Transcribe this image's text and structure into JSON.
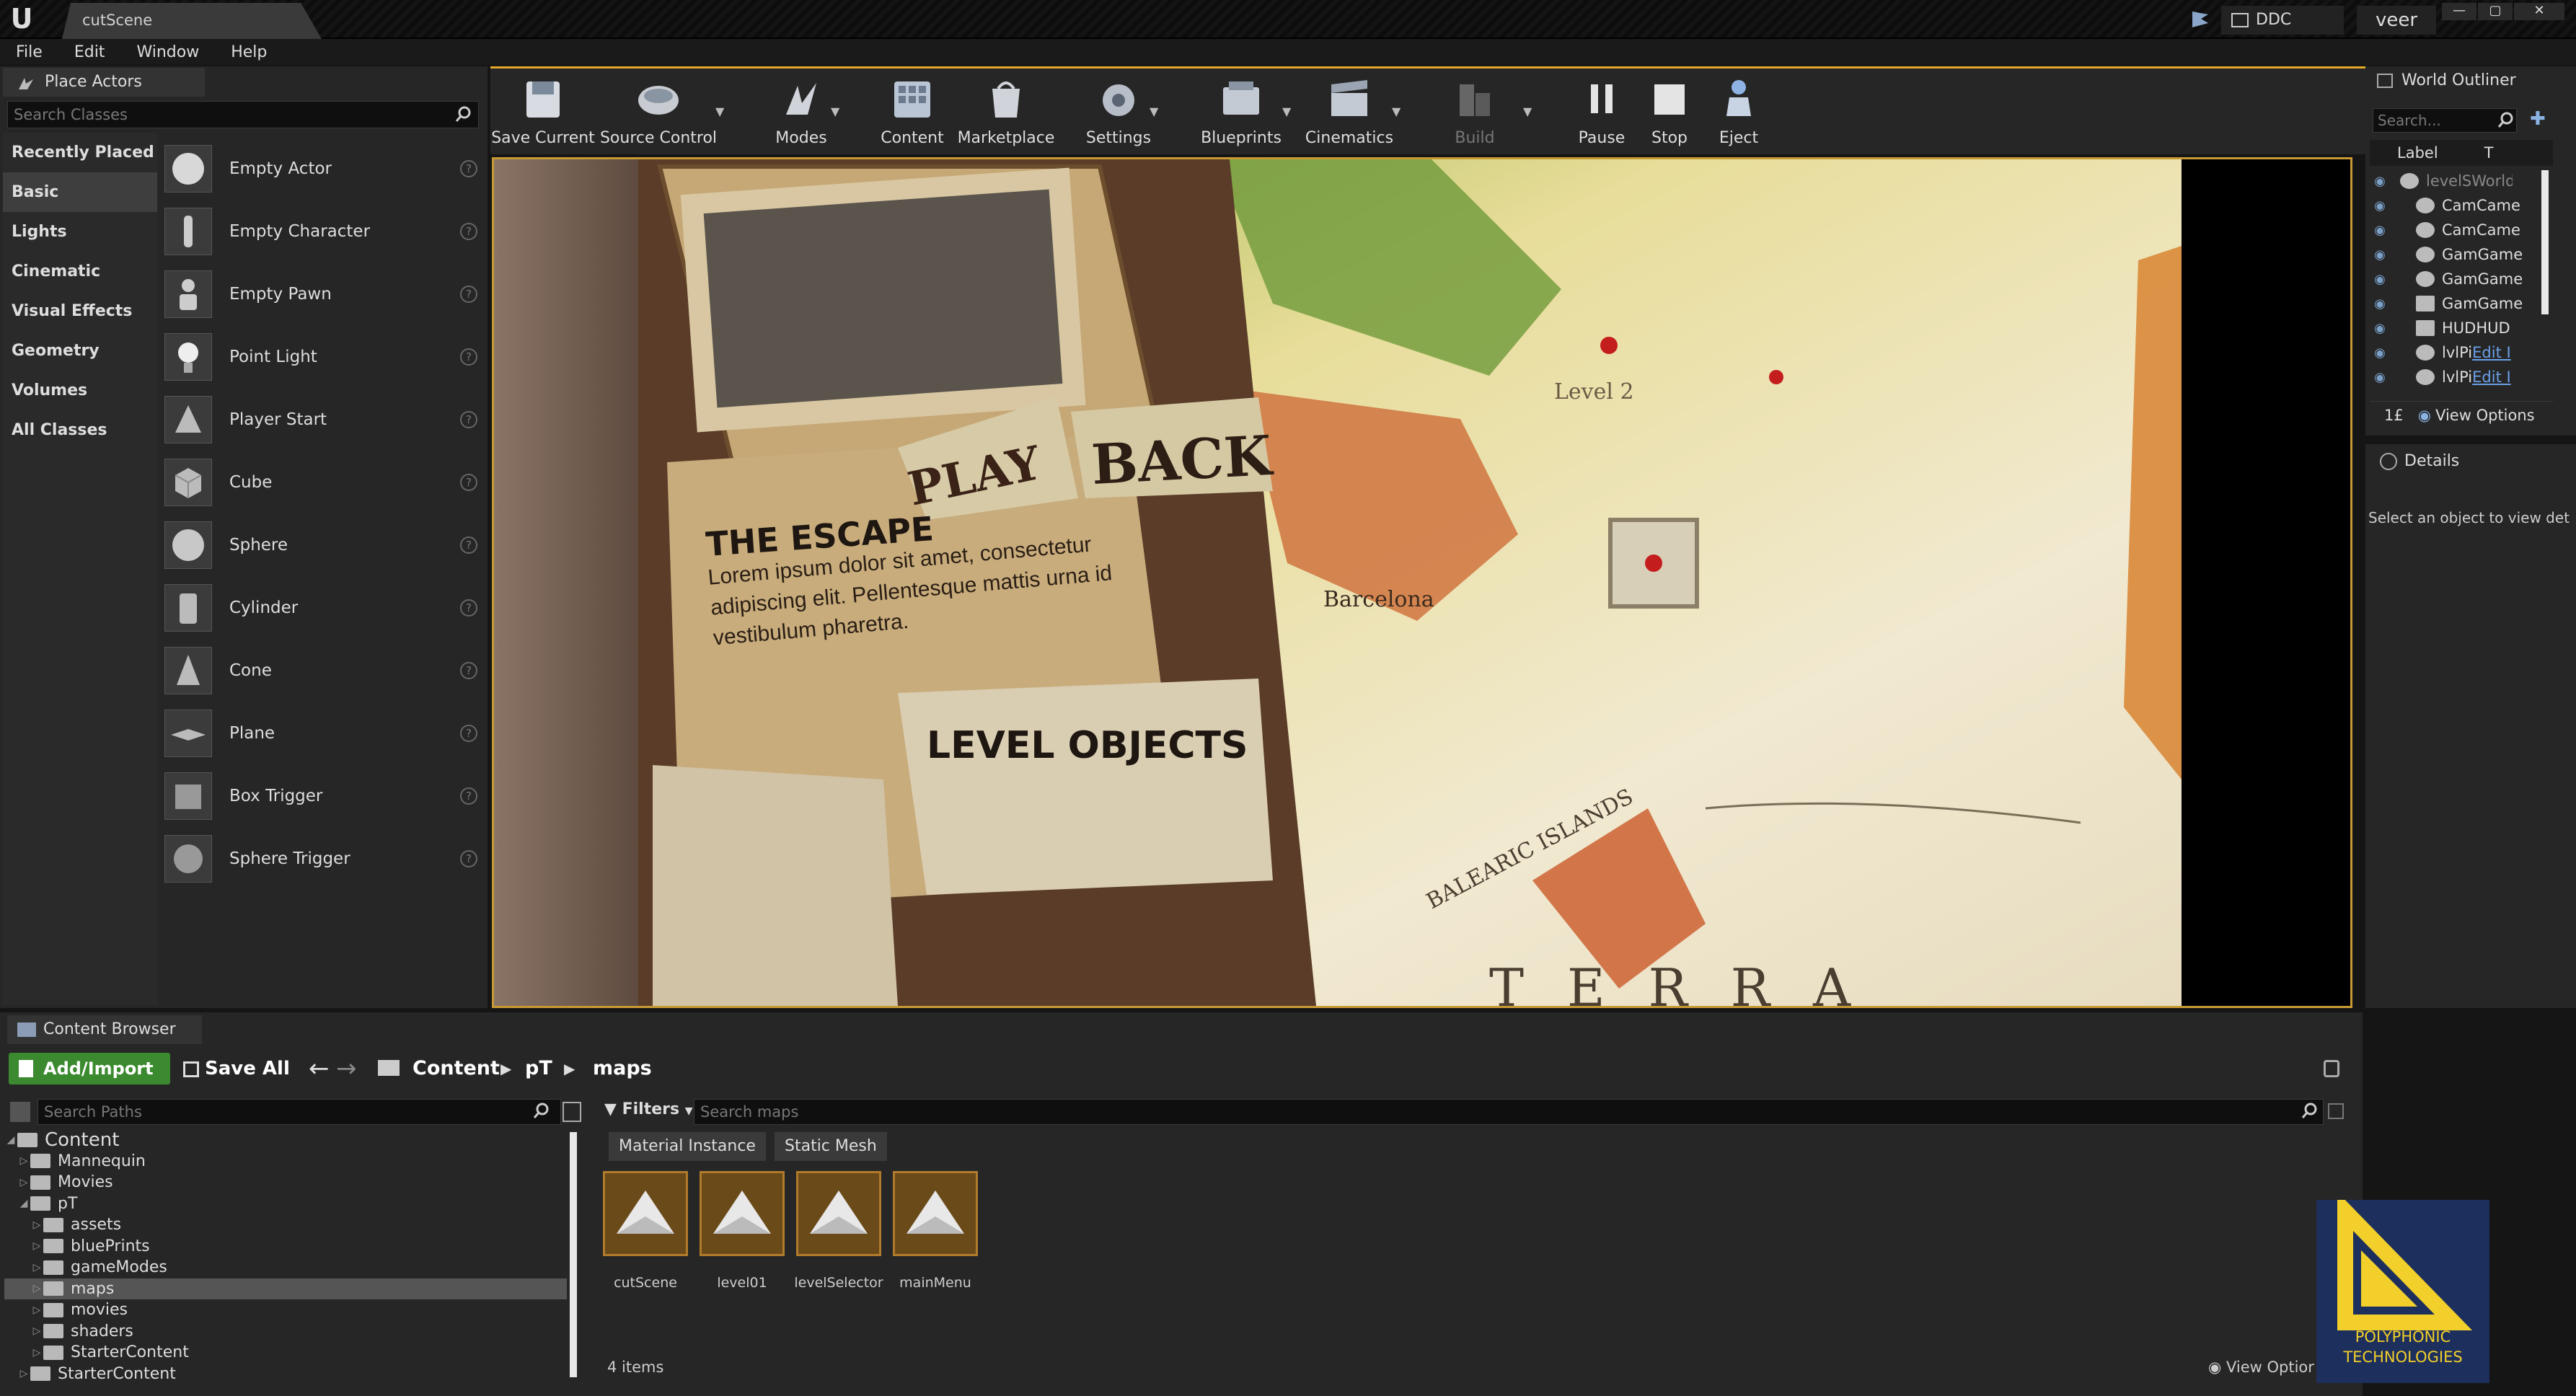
{
  "window": {
    "tab_title": "cutScene",
    "ddc_label": "DDC",
    "user_label": "veer",
    "controls": {
      "minimize": "—",
      "maximize": "▢",
      "close": "✕"
    }
  },
  "menu": [
    "File",
    "Edit",
    "Window",
    "Help"
  ],
  "place_actors": {
    "tab_label": "Place Actors",
    "search_placeholder": "Search Classes",
    "categories": [
      "Recently Placed",
      "Basic",
      "Lights",
      "Cinematic",
      "Visual Effects",
      "Geometry",
      "Volumes",
      "All Classes"
    ],
    "active_category": "Basic",
    "actors": [
      {
        "label": "Empty Actor",
        "icon": "sphere-icon"
      },
      {
        "label": "Empty Character",
        "icon": "character-icon"
      },
      {
        "label": "Empty Pawn",
        "icon": "pawn-icon"
      },
      {
        "label": "Point Light",
        "icon": "lightbulb-icon"
      },
      {
        "label": "Player Start",
        "icon": "player-start-icon"
      },
      {
        "label": "Cube",
        "icon": "cube-icon"
      },
      {
        "label": "Sphere",
        "icon": "sphere-icon"
      },
      {
        "label": "Cylinder",
        "icon": "cylinder-icon"
      },
      {
        "label": "Cone",
        "icon": "cone-icon"
      },
      {
        "label": "Plane",
        "icon": "plane-icon"
      },
      {
        "label": "Box Trigger",
        "icon": "box-trigger-icon"
      },
      {
        "label": "Sphere Trigger",
        "icon": "sphere-trigger-icon"
      }
    ]
  },
  "toolbar": {
    "items": [
      {
        "label": "Save Current",
        "icon": "save-icon"
      },
      {
        "label": "Source Control",
        "icon": "source-control-icon"
      },
      {
        "label": "Modes",
        "icon": "modes-icon"
      },
      {
        "label": "Content",
        "icon": "content-icon"
      },
      {
        "label": "Marketplace",
        "icon": "marketplace-icon"
      },
      {
        "label": "Settings",
        "icon": "settings-icon"
      },
      {
        "label": "Blueprints",
        "icon": "blueprints-icon"
      },
      {
        "label": "Cinematics",
        "icon": "cinematics-icon"
      },
      {
        "label": "Build",
        "icon": "build-icon",
        "disabled": true
      },
      {
        "label": "Pause",
        "icon": "pause-icon"
      },
      {
        "label": "Stop",
        "icon": "stop-icon"
      },
      {
        "label": "Eject",
        "icon": "eject-icon"
      }
    ]
  },
  "viewport": {
    "heading": "THE ESCAPE",
    "body_text": "Lorem ipsum dolor sit amet, consectetur adipiscing elit. Pellentesque mattis urna id vestibulum pharetra.",
    "play_label": "PLAY",
    "back_label": "BACK",
    "level_objects_label": "LEVEL OBJECTS",
    "map_labels": [
      "Level 2",
      "Barcelona",
      "BALEARIC ISLANDS",
      "TERRA"
    ],
    "accent_color": "#c89a34"
  },
  "world_outliner": {
    "tab_label": "World Outliner",
    "search_placeholder": "Search...",
    "col_label": "Label",
    "col_type": "T",
    "rows": [
      {
        "label": "levelSWorld",
        "dim": true
      },
      {
        "label": "CamCame"
      },
      {
        "label": "CamCame"
      },
      {
        "label": "GamGame"
      },
      {
        "label": "GamGame"
      },
      {
        "label": "GamGame"
      },
      {
        "label": "HUDHUD"
      },
      {
        "label": "lvlPi",
        "edit": "Edit I"
      },
      {
        "label": "lvlPi",
        "edit": "Edit I"
      }
    ],
    "count": "1£",
    "view_options": "View Options"
  },
  "details": {
    "tab_label": "Details",
    "hint": "Select an object to view det"
  },
  "content_browser": {
    "tab_label": "Content Browser",
    "add_import": "Add/Import",
    "save_all": "Save All",
    "breadcrumb": [
      "Content",
      "pT",
      "maps"
    ],
    "paths_placeholder": "Search Paths",
    "filters_label": "Filters",
    "search_placeholder": "Search maps",
    "filter_chips": [
      "Material Instance",
      "Static Mesh"
    ],
    "tree": [
      {
        "label": "Content",
        "depth": 0,
        "expanded": true
      },
      {
        "label": "Mannequin",
        "depth": 1
      },
      {
        "label": "Movies",
        "depth": 1
      },
      {
        "label": "pT",
        "depth": 1,
        "expanded": true
      },
      {
        "label": "assets",
        "depth": 2
      },
      {
        "label": "bluePrints",
        "depth": 2
      },
      {
        "label": "gameModes",
        "depth": 2
      },
      {
        "label": "maps",
        "depth": 2,
        "selected": true
      },
      {
        "label": "movies",
        "depth": 2
      },
      {
        "label": "shaders",
        "depth": 2
      },
      {
        "label": "StarterContent",
        "depth": 2
      },
      {
        "label": "StarterContent",
        "depth": 1
      }
    ],
    "assets": [
      "cutScene",
      "level01",
      "levelSelector",
      "mainMenu"
    ],
    "item_count": "4 items",
    "view_options": "View Optior"
  },
  "logo": {
    "line1": "POLYPHONIC",
    "line2": "TECHNOLOGIES",
    "color": "#f2cf2a"
  }
}
